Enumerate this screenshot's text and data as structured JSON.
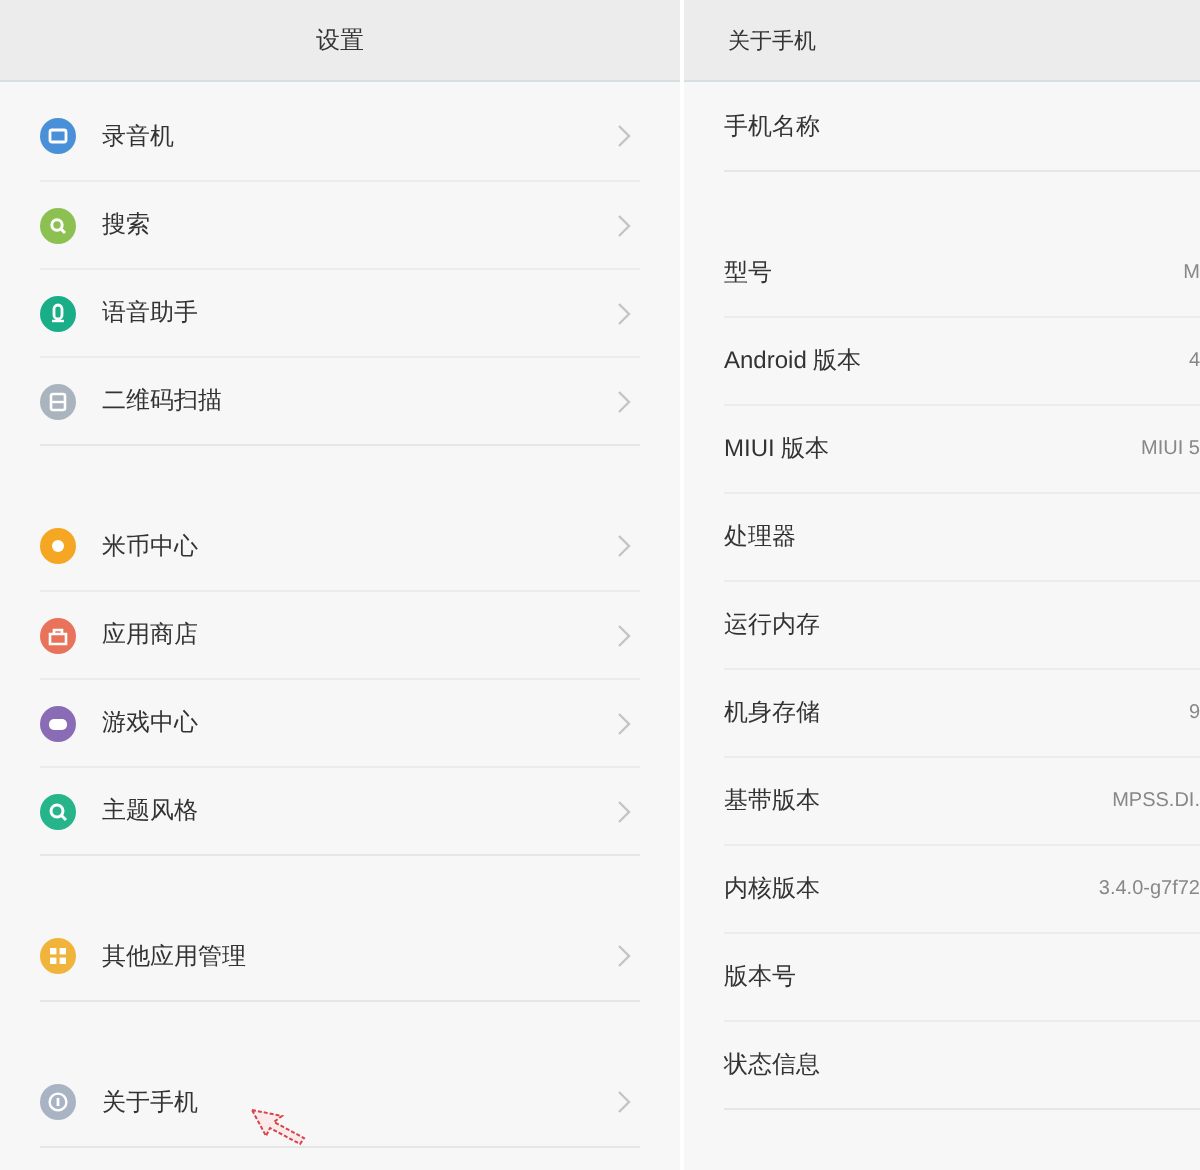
{
  "settings_panel": {
    "title": "设置",
    "groups": [
      {
        "items": [
          {
            "label": "录音机",
            "color": "#4a90d9"
          },
          {
            "label": "搜索",
            "color": "#8cc152"
          },
          {
            "label": "语音助手",
            "color": "#1aae88"
          },
          {
            "label": "二维码扫描",
            "color": "#aab4be"
          }
        ]
      },
      {
        "items": [
          {
            "label": "米币中心",
            "color": "#f5a623"
          },
          {
            "label": "应用商店",
            "color": "#e8735a"
          },
          {
            "label": "游戏中心",
            "color": "#8a6bb5"
          },
          {
            "label": "主题风格",
            "color": "#26b48a"
          }
        ]
      },
      {
        "items": [
          {
            "label": "其他应用管理",
            "color": "#f0b43c"
          }
        ]
      },
      {
        "items": [
          {
            "label": "关于手机",
            "color": "#a8b4c4",
            "pointer": true
          }
        ]
      }
    ]
  },
  "about_panel": {
    "title": "关于手机",
    "groups": [
      {
        "items": [
          {
            "label": "手机名称"
          }
        ]
      },
      {
        "items": [
          {
            "label": "型号",
            "value": "M"
          },
          {
            "label": "Android 版本",
            "value": "4"
          },
          {
            "label": "MIUI 版本",
            "value": "MIUI 5"
          },
          {
            "label": "处理器"
          },
          {
            "label": "运行内存"
          },
          {
            "label": "机身存储",
            "value": "9"
          },
          {
            "label": "基带版本",
            "value": "MPSS.DI."
          },
          {
            "label": "内核版本",
            "value": "3.4.0-g7f72"
          },
          {
            "label": "版本号"
          },
          {
            "label": "状态信息"
          }
        ]
      }
    ]
  }
}
